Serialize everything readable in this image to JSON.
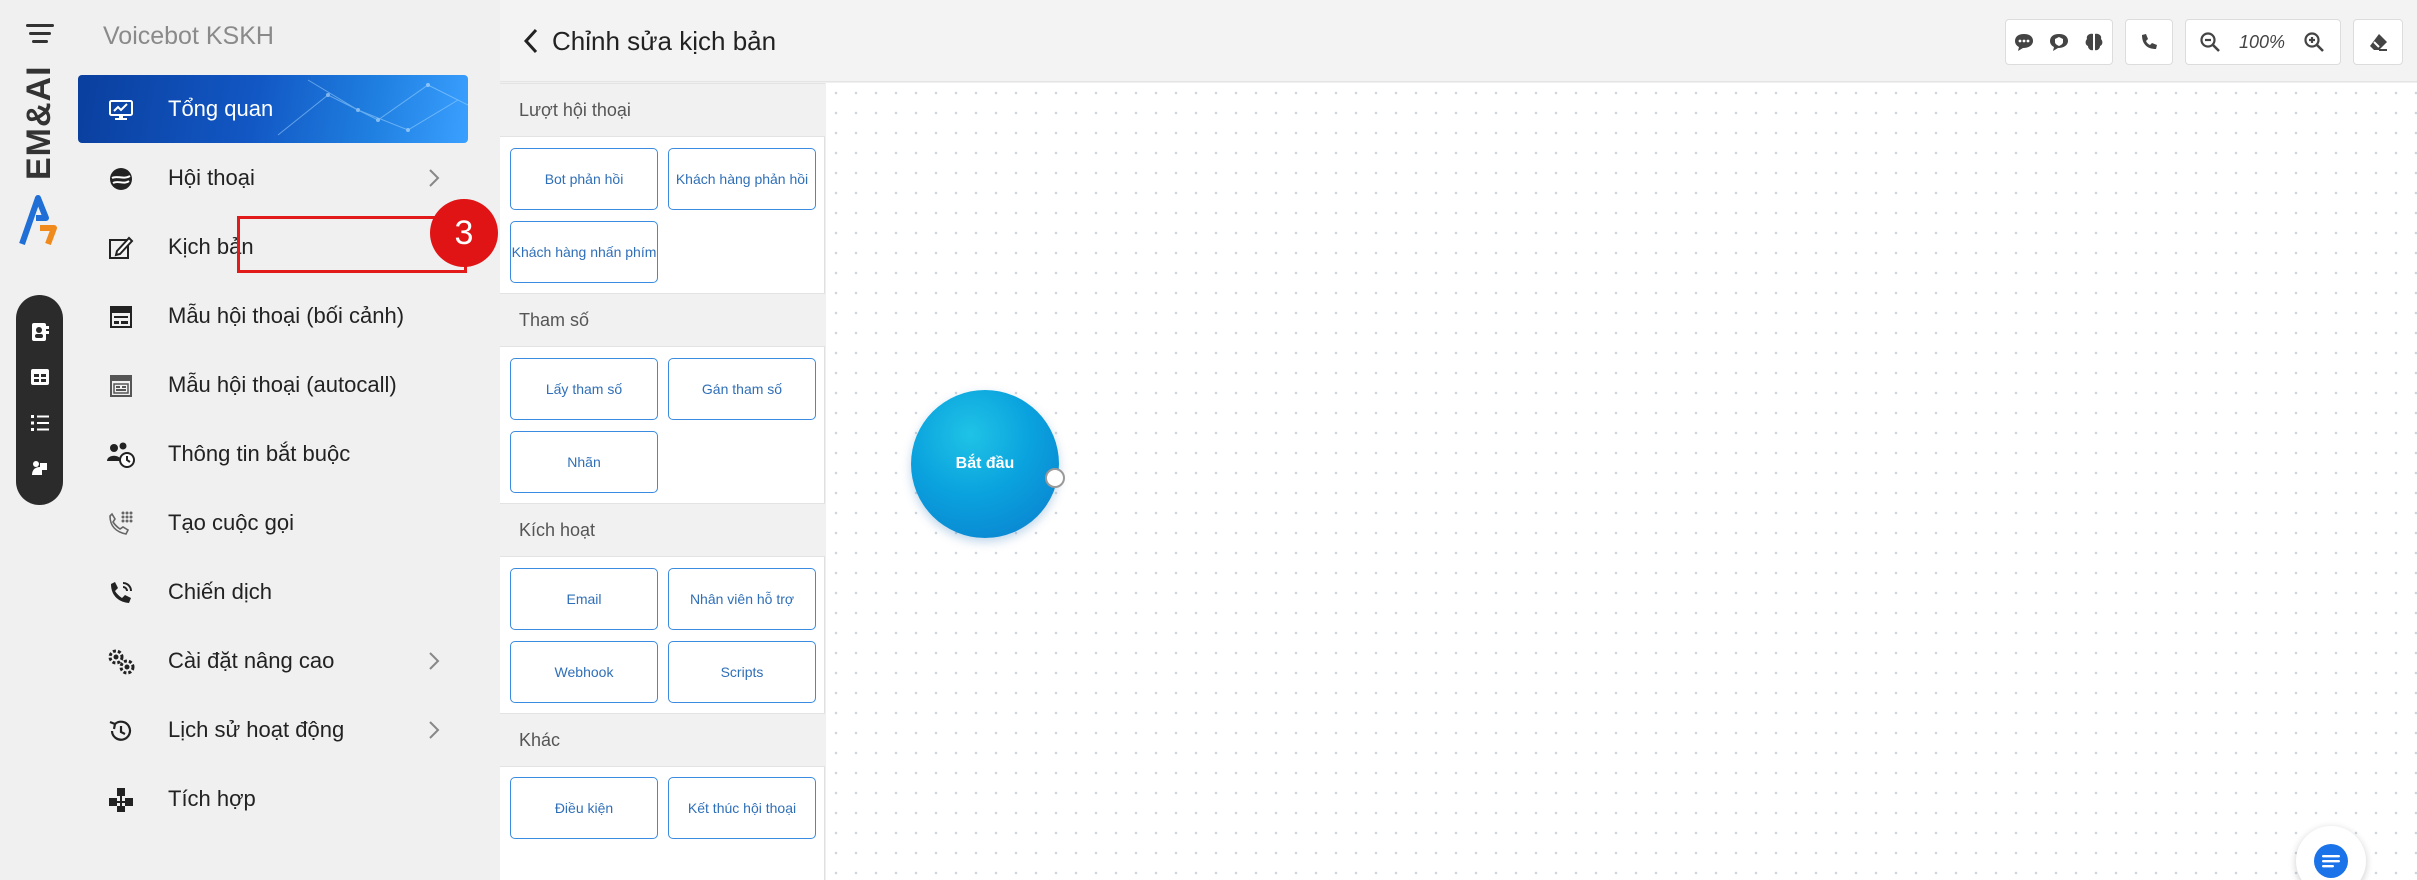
{
  "rail": {
    "brand": "EM&AI",
    "icons": [
      "contacts-icon",
      "table-icon",
      "checklist-icon",
      "support-icon"
    ]
  },
  "sidebar": {
    "bot_name": "Voicebot KSKH",
    "items": [
      {
        "label": "Tổng quan",
        "icon": "dashboard-icon",
        "active": true,
        "has_children": false
      },
      {
        "label": "Hội thoại",
        "icon": "conversation-icon",
        "active": false,
        "has_children": true
      },
      {
        "label": "Kịch bản",
        "icon": "script-edit-icon",
        "active": false,
        "has_children": false
      },
      {
        "label": "Mẫu hội thoại (bối cảnh)",
        "icon": "template-icon",
        "active": false,
        "has_children": false
      },
      {
        "label": "Mẫu hội thoại (autocall)",
        "icon": "autocall-template-icon",
        "active": false,
        "has_children": false
      },
      {
        "label": "Thông tin bắt buộc",
        "icon": "required-info-icon",
        "active": false,
        "has_children": false
      },
      {
        "label": "Tạo cuộc gọi",
        "icon": "dialpad-icon",
        "active": false,
        "has_children": false
      },
      {
        "label": "Chiến dịch",
        "icon": "campaign-phone-icon",
        "active": false,
        "has_children": false
      },
      {
        "label": "Cài đặt nâng cao",
        "icon": "settings-icon",
        "active": false,
        "has_children": true
      },
      {
        "label": "Lịch sử hoạt động",
        "icon": "history-icon",
        "active": false,
        "has_children": true
      },
      {
        "label": "Tích hợp",
        "icon": "integration-icon",
        "active": false,
        "has_children": false
      }
    ],
    "annotation": {
      "label": "3",
      "color": "#e01414"
    }
  },
  "header": {
    "title": "Chỉnh sửa kịch bản",
    "zoom": "100%"
  },
  "palette": {
    "sections": [
      {
        "title": "Lượt hội thoại",
        "buttons": [
          "Bot phản hồi",
          "Khách hàng phản hồi",
          "Khách hàng nhấn phím"
        ]
      },
      {
        "title": "Tham số",
        "buttons": [
          "Lấy tham số",
          "Gán tham số",
          "Nhãn"
        ]
      },
      {
        "title": "Kích hoạt",
        "buttons": [
          "Email",
          "Nhân viên hỗ trợ",
          "Webhook",
          "Scripts"
        ]
      },
      {
        "title": "Khác",
        "buttons": [
          "Điều kiện",
          "Kết thúc hội thoại"
        ]
      }
    ]
  },
  "canvas": {
    "start_node_label": "Bắt đầu"
  },
  "colors": {
    "accent": "#1257c4",
    "button_border": "#3b8be0",
    "node": "#0aa2de"
  }
}
